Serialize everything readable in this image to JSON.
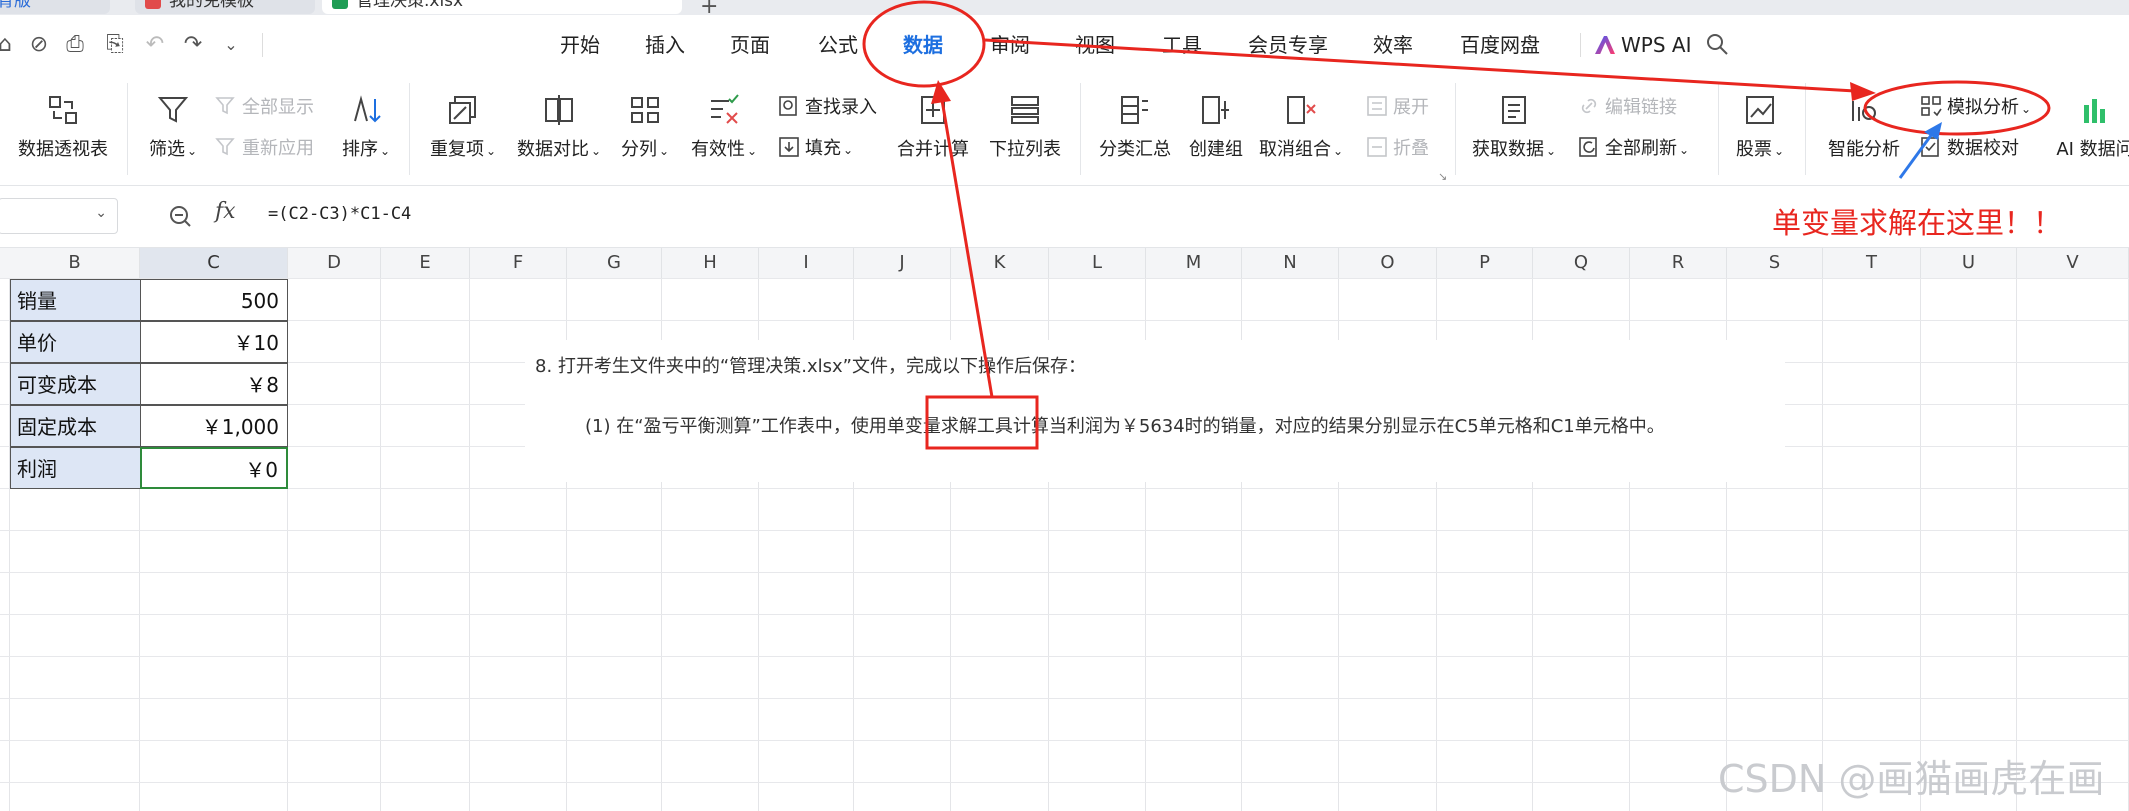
{
  "doc_tabs": [
    {
      "label": "教育版"
    },
    {
      "label": "我的免模板"
    },
    {
      "label": "管理决策.xlsx"
    }
  ],
  "menu": {
    "items": [
      "开始",
      "插入",
      "页面",
      "公式",
      "数据",
      "审阅",
      "视图",
      "工具",
      "会员专享",
      "效率",
      "百度网盘"
    ],
    "active": "数据",
    "wps_ai": "WPS AI"
  },
  "ribbon": {
    "pivot": "数据透视表",
    "filter": "筛选",
    "show_all": "全部显示",
    "reapply": "重新应用",
    "sort": "排序",
    "duplicates": "重复项",
    "compare": "数据对比",
    "split": "分列",
    "validity": "有效性",
    "find_entry": "查找录入",
    "fill": "填充",
    "consolidate": "合并计算",
    "dropdown_list": "下拉列表",
    "subtotal": "分类汇总",
    "group": "创建组",
    "ungroup": "取消组合",
    "expand": "展开",
    "collapse": "折叠",
    "get_data": "获取数据",
    "edit_links": "编辑链接",
    "refresh_all": "全部刷新",
    "stocks": "股票",
    "smart_analysis": "智能分析",
    "what_if": "模拟分析",
    "data_check": "数据校对",
    "ai_data": "AI 数据问"
  },
  "formula_bar": {
    "name_box": "",
    "fx": "fx",
    "formula": "=(C2-C3)*C1-C4"
  },
  "columns": [
    "B",
    "C",
    "D",
    "E",
    "F",
    "G",
    "H",
    "I",
    "J",
    "K",
    "L",
    "M",
    "N",
    "O",
    "P",
    "Q",
    "R",
    "S",
    "T",
    "U",
    "V"
  ],
  "selected_column": "C",
  "cells": [
    {
      "label": "销量",
      "value": "500"
    },
    {
      "label": "单价",
      "value": "￥10"
    },
    {
      "label": "可变成本",
      "value": "￥8"
    },
    {
      "label": "固定成本",
      "value": "￥1,000"
    },
    {
      "label": "利润",
      "value": "￥0"
    }
  ],
  "question": {
    "line1": "8. 打开考生文件夹中的“管理决策.xlsx”文件，完成以下操作后保存：",
    "line2": "(1) 在“盈亏平衡测算”工作表中，使用单变量求解工具计算当利润为￥5634时的销量，对应的结果分别显示在C5单元格和C1单元格中。"
  },
  "annotation": {
    "text": "单变量求解在这里！！",
    "color": "#e8261f"
  },
  "watermark": "CSDN @画猫画虎在画",
  "colors": {
    "accent": "#1d6fe0",
    "label_fill": "#dde6f5",
    "active_cell_border": "#2e8b3b"
  }
}
